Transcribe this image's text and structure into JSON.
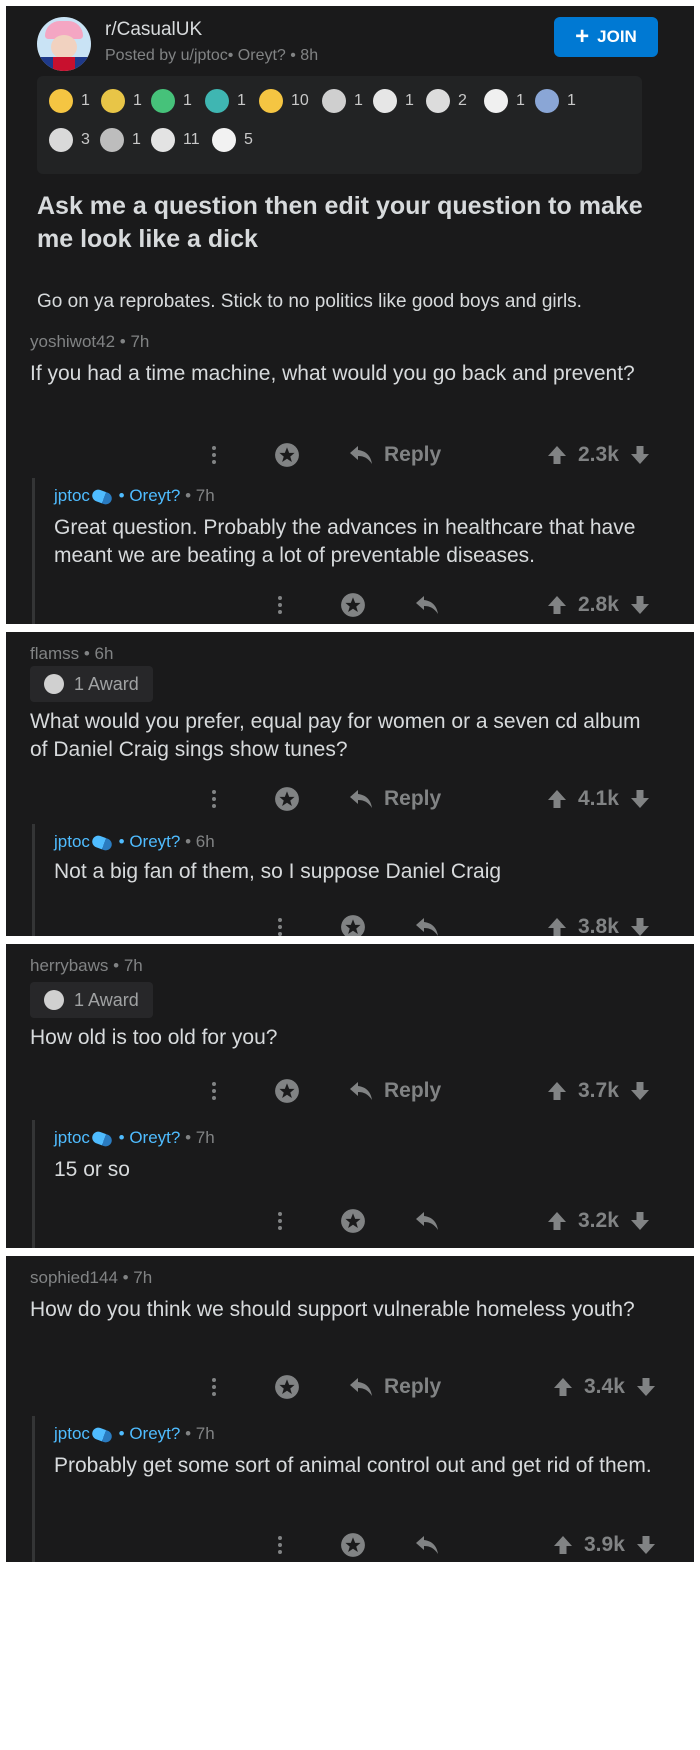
{
  "post": {
    "subreddit": "r/CasualUK",
    "posted_by": "Posted by u/jptoc• Oreyt? • 8h",
    "join_label": "JOIN",
    "title": "Ask me a question then edit your question to make me look like a dick",
    "body": "Go on ya reprobates. Stick to no politics like good boys and girls.",
    "awards": [
      {
        "icon": "gold-coin-award-icon",
        "count": "1",
        "color": "#f5c542"
      },
      {
        "icon": "gold-helmet-award-icon",
        "count": "1",
        "color": "#e8c547"
      },
      {
        "icon": "frog-award-icon",
        "count": "1",
        "color": "#46c27a"
      },
      {
        "icon": "teal-coin-award-icon",
        "count": "1",
        "color": "#3fb6b2"
      },
      {
        "icon": "star-medal-award-icon",
        "count": "10",
        "color": "#f5c542"
      },
      {
        "icon": "skeleton-hand-award-icon",
        "count": "1",
        "color": "#cfcfcf"
      },
      {
        "icon": "ghost-award-icon",
        "count": "1",
        "color": "#e6e6e6"
      },
      {
        "icon": "skull-microphone-award-icon",
        "count": "2",
        "color": "#dcdcdc"
      },
      {
        "icon": "white-hand-award-icon",
        "count": "1",
        "color": "#f0f0f0"
      },
      {
        "icon": "figure-award-icon",
        "count": "1",
        "color": "#8aa6d6"
      },
      {
        "icon": "skull-award-icon",
        "count": "3",
        "color": "#d9d9d9"
      },
      {
        "icon": "explosion-award-icon",
        "count": "1",
        "color": "#bdbdbd"
      },
      {
        "icon": "s-coin-award-icon",
        "count": "11",
        "color": "#e3e3e3"
      },
      {
        "icon": "snoo-award-icon",
        "count": "5",
        "color": "#f2f2f2"
      }
    ]
  },
  "comments": [
    {
      "author": "yoshiwot42 • 7h",
      "text": "If you had a time machine, what would you go back and prevent?",
      "reply_label": "Reply",
      "score": "2.3k",
      "reply": {
        "author": "jptoc",
        "flair": "• Oreyt?",
        "time": "• 7h",
        "text": "Great question. Probably the advances in healthcare that have meant we are beating a lot of preventable diseases.",
        "score": "2.8k"
      }
    },
    {
      "author": "flamss • 6h",
      "award": "1 Award",
      "text": "What would you prefer, equal pay for women or a seven cd album of Daniel Craig sings show tunes?",
      "reply_label": "Reply",
      "score": "4.1k",
      "reply": {
        "author": "jptoc",
        "flair": "• Oreyt?",
        "time": "• 6h",
        "text": "Not a big fan of them, so I suppose Daniel Craig",
        "score": "3.8k"
      }
    },
    {
      "author": "herrybaws • 7h",
      "award": "1 Award",
      "text": "How old is too old for you?",
      "reply_label": "Reply",
      "score": "3.7k",
      "reply": {
        "author": "jptoc",
        "flair": "• Oreyt?",
        "time": "• 7h",
        "text": "15 or so",
        "score": "3.2k"
      }
    },
    {
      "author": "sophied144 • 7h",
      "text": "How do you think we should support vulnerable homeless youth?",
      "reply_label": "Reply",
      "score": "3.4k",
      "reply": {
        "author": "jptoc",
        "flair": "• Oreyt?",
        "time": "• 7h",
        "text": "Probably get some sort of animal control out and get rid of them.",
        "score": "3.9k"
      }
    }
  ]
}
